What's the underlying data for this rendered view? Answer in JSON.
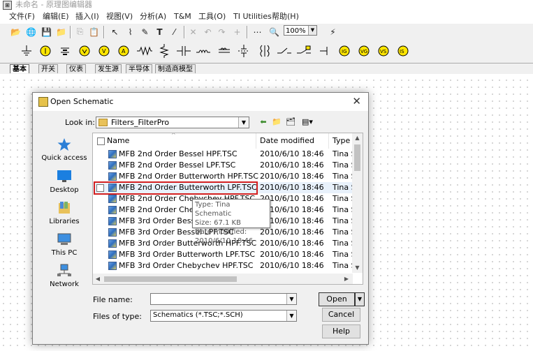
{
  "app": {
    "title": "未命名 - 原理图编辑器"
  },
  "menu": [
    "文件(F)",
    "编辑(E)",
    "插入(I)",
    "视图(V)",
    "分析(A)",
    "T&M",
    "工具(O)",
    "TI Utilities",
    "帮助(H)"
  ],
  "toolbar": {
    "zoom": "100%"
  },
  "component_tabs": [
    "基本",
    "开关",
    "仪表",
    "发生源",
    "半导体",
    "制造商模型"
  ],
  "dialog": {
    "title": "Open Schematic",
    "look_in_label": "Look in:",
    "look_in_value": "Filters_FilterPro",
    "places": [
      "Quick access",
      "Desktop",
      "Libraries",
      "This PC",
      "Network"
    ],
    "columns": {
      "name": "Name",
      "date": "Date modified",
      "type": "Type"
    },
    "files": [
      {
        "name": "MFB 2nd Order Bessel HPF.TSC",
        "date": "2010/6/10 18:46",
        "type": "Tina S․"
      },
      {
        "name": "MFB 2nd Order Bessel LPF.TSC",
        "date": "2010/6/10 18:46",
        "type": "Tina S․"
      },
      {
        "name": "MFB 2nd Order Butterworth HPF.TSC",
        "date": "2010/6/10 18:46",
        "type": "Tina S․"
      },
      {
        "name": "MFB 2nd Order Butterworth LPF.TSC",
        "date": "2010/6/10 18:46",
        "type": "Tina S․"
      },
      {
        "name": "MFB 2nd Order Chebychev HPF.TSC",
        "date": "2010/6/10 18:46",
        "type": "Tina S․"
      },
      {
        "name": "MFB 2nd Order Chebychev LPF.TSC",
        "date": "2010/6/10 18:46",
        "type": "Tina S․"
      },
      {
        "name": "MFB 3rd Order Bessel HPF.TSC",
        "date": "2010/6/10 18:46",
        "type": "Tina S․"
      },
      {
        "name": "MFB 3rd Order Bessel LPF.TSC",
        "date": "2010/6/10 18:46",
        "type": "Tina S․"
      },
      {
        "name": "MFB 3rd Order Butterworth HPF.TSC",
        "date": "2010/6/10 18:46",
        "type": "Tina S․"
      },
      {
        "name": "MFB 3rd Order Butterworth LPF.TSC",
        "date": "2010/6/10 18:46",
        "type": "Tina S․"
      },
      {
        "name": "MFB 3rd Order Chebychev HPF.TSC",
        "date": "2010/6/10 18:46",
        "type": "Tina S․"
      }
    ],
    "tooltip": {
      "type": "Type: Tina Schematic",
      "size": "Size: 67.1 KB",
      "date": "Date modified: 2010/6/10 18:46"
    },
    "file_name_label": "File name:",
    "file_name_value": "",
    "files_of_type_label": "Files of type:",
    "files_of_type_value": "Schematics (*.TSC;*.SCH)",
    "buttons": {
      "open": "Open",
      "cancel": "Cancel",
      "help": "Help"
    }
  }
}
